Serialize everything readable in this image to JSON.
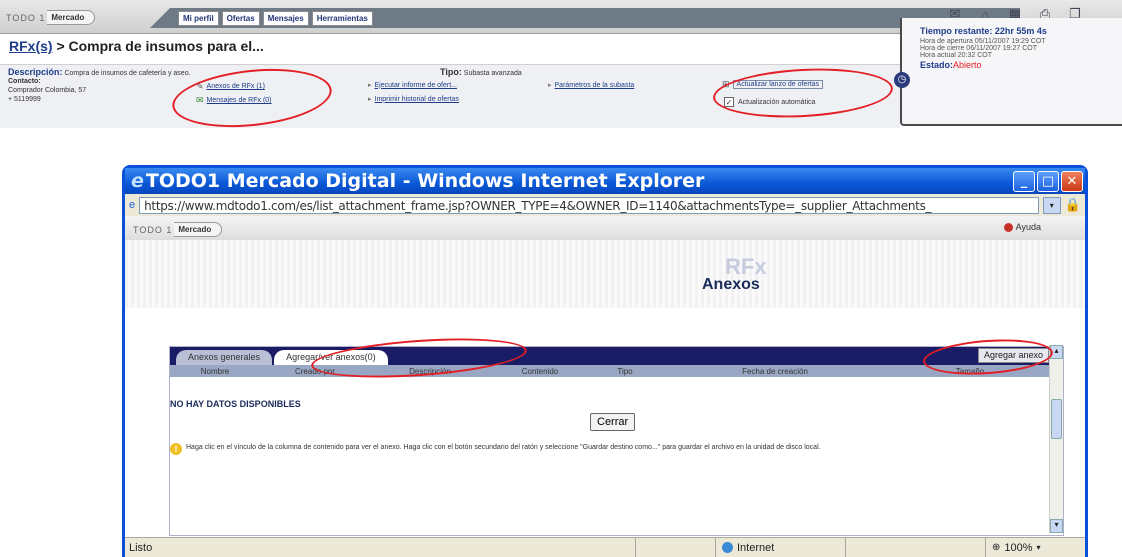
{
  "app": {
    "logo_todo": "TODO 1",
    "logo_mercado": "Mercado",
    "menu": [
      "Mi perfil",
      "Ofertas",
      "Mensajes",
      "Herramientas"
    ]
  },
  "header": {
    "rfx_link": "RFx(s)",
    "title_rest": " > Compra de insumos para el..."
  },
  "info": {
    "descripcion_label": "Descripción:",
    "descripcion_value": "Compra de insumos de cafetería y aseo.",
    "contacto_label": "Contacto:",
    "contacto_value": "Comprador Colombia, 57 + 5119999",
    "anexos_link": "Anexos de RFx (1)",
    "mensajes_link": "Mensajes de RFx (0)",
    "tipo_label": "Tipo:",
    "tipo_value": "Subasta avanzada",
    "ejecutar_link": "Ejecutar informe de ofert...",
    "imprimir_link": "Imprimir historial de ofertas",
    "parametros_link": "Parámetros de la subasta",
    "actualizar_link": "Actualizar lanzo de ofertas",
    "auto_update_label": "Actualización automática",
    "auto_update_checked": true
  },
  "timer": {
    "tiempo_restante": "Tiempo restante: 22hr 55m 4s",
    "hora_apertura": "Hora de apertura 05/11/2007 19:29 COT",
    "hora_cierre": "Hora de cierre 06/11/2007 19:27 COT",
    "hora_actual": "Hora actual 20:32 COT",
    "estado_label": "Estado:",
    "estado_value": "Abierto"
  },
  "ie": {
    "title": "TODO1 Mercado Digital - Windows Internet Explorer",
    "url": "https://www.mdtodo1.com/es/list_attachment_frame.jsp?OWNER_TYPE=4&OWNER_ID=1140&attachmentsType=_supplier_Attachments_",
    "status_text": "Listo",
    "zone_text": "Internet",
    "zoom_text": "100%"
  },
  "page": {
    "logo_todo": "TODO 1",
    "logo_mercado": "Mercado",
    "ayuda": "Ayuda",
    "rfx_mark": "RFx",
    "heading": "Anexos",
    "tabs": [
      "Anexos generales",
      "Agregar/ver anexos(0)"
    ],
    "add_button": "Agregar anexo",
    "columns": [
      "Nombre",
      "Creado por",
      "Descripción",
      "Contenido",
      "Tipo",
      "Fecha de creación",
      "Tamaño"
    ],
    "no_data": "NO HAY DATOS DISPONIBLES",
    "close_button": "Cerrar",
    "help_text": "Haga clic en el vínculo de la columna de contenido para ver el anexo. Haga clic con el botón secundario del ratón y seleccione \"Guardar destino como...\" para guardar el archivo en la unidad de disco local."
  },
  "colors": {
    "accent_red": "#e31e24",
    "ie_blue": "#0a57d6",
    "tabs_navy": "#1a1c66"
  }
}
